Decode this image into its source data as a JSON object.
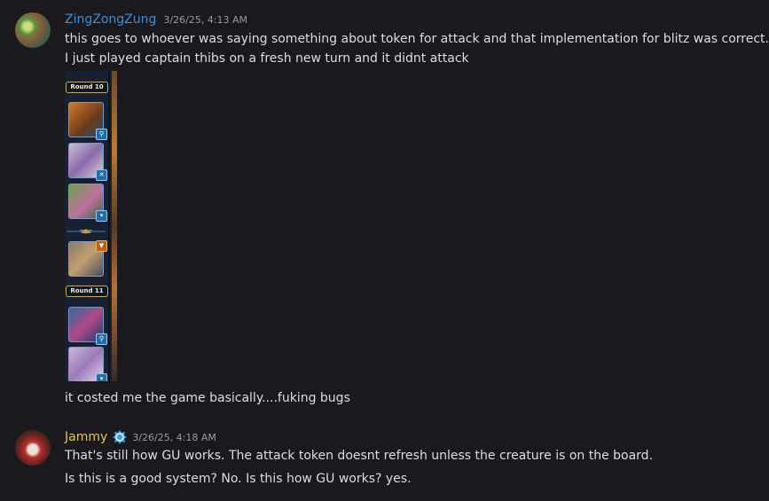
{
  "messages": [
    {
      "author": "ZingZongZung",
      "author_color": "#3b8fd6",
      "timestamp": "3/26/25, 4:13 AM",
      "lines": [
        "this goes to whoever was saying something about token for attack and that implementation for blitz was correct..",
        "I just played captain thibs on a fresh new turn and it didnt attack"
      ],
      "attachment": {
        "rounds": [
          "Round 10",
          "Round 11"
        ]
      },
      "after_text": "it costed me the game basically....fuking bugs"
    },
    {
      "author": "Jammy",
      "author_color": "#f0c33a",
      "timestamp": "3/26/25, 4:18 AM",
      "badge_icon": "guild-badge-icon",
      "lines": [
        "That's still how GU works. The attack token doesnt refresh unless the creature is on the board.",
        "Is this is a good system? No. Is this how GU works? yes."
      ]
    }
  ]
}
